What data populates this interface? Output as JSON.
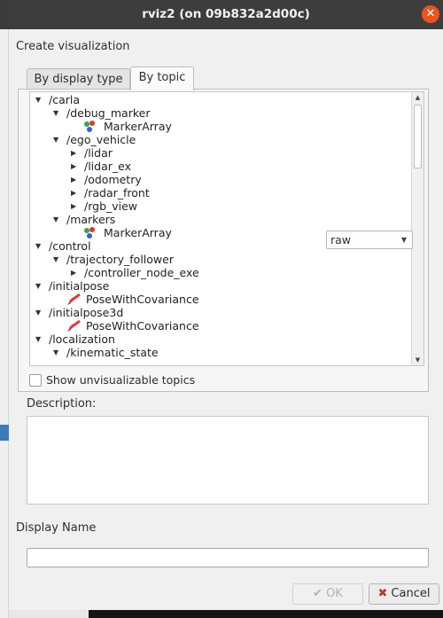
{
  "window": {
    "title": "rviz2 (on 09b832a2d00c)"
  },
  "header": {
    "create_label": "Create visualization"
  },
  "tabs": [
    {
      "label": "By display type"
    },
    {
      "label": "By topic"
    }
  ],
  "tree": {
    "rows": [
      {
        "text": "/carla",
        "level": 0,
        "arrow": "open"
      },
      {
        "text": "/debug_marker",
        "level": 1,
        "arrow": "open"
      },
      {
        "text": "MarkerArray",
        "level": 2,
        "icon": "marker-array-icon"
      },
      {
        "text": "/ego_vehicle",
        "level": 1,
        "arrow": "open"
      },
      {
        "text": "/lidar",
        "level": 2,
        "arrow": "closed"
      },
      {
        "text": "/lidar_ex",
        "level": 2,
        "arrow": "closed"
      },
      {
        "text": "/odometry",
        "level": 2,
        "arrow": "closed"
      },
      {
        "text": "/radar_front",
        "level": 2,
        "arrow": "closed"
      },
      {
        "text": "/rgb_view",
        "level": 2,
        "arrow": "closed"
      },
      {
        "text": "/markers",
        "level": 1,
        "arrow": "open"
      },
      {
        "text": "MarkerArray",
        "level": 2,
        "icon": "marker-array-icon"
      },
      {
        "text": "/control",
        "level": 0,
        "arrow": "open"
      },
      {
        "text": "/trajectory_follower",
        "level": 1,
        "arrow": "open"
      },
      {
        "text": "/controller_node_exe",
        "level": 2,
        "arrow": "closed"
      },
      {
        "text": "/initialpose",
        "level": 0,
        "arrow": "open"
      },
      {
        "text": "PoseWithCovariance",
        "level": 1,
        "icon": "pose-icon"
      },
      {
        "text": "/initialpose3d",
        "level": 0,
        "arrow": "open"
      },
      {
        "text": "PoseWithCovariance",
        "level": 1,
        "icon": "pose-icon"
      },
      {
        "text": "/localization",
        "level": 0,
        "arrow": "open"
      },
      {
        "text": "/kinematic_state",
        "level": 1,
        "arrow": "open"
      }
    ],
    "markers_combo_value": "raw"
  },
  "show_unvisualizable_label": "Show unvisualizable topics",
  "description_label": "Description:",
  "display_name_label": "Display Name",
  "buttons": {
    "ok": "OK",
    "cancel": "Cancel"
  },
  "colors": {
    "accent": "#e95420",
    "titlebar": "#3d3d3d"
  }
}
